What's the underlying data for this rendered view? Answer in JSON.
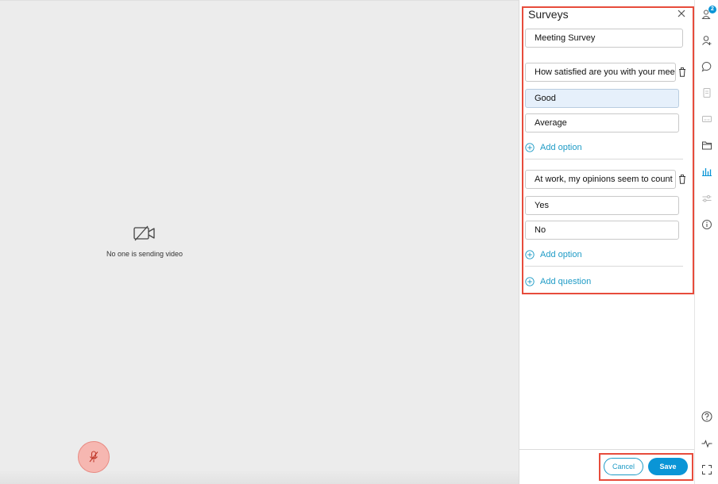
{
  "stage": {
    "no_video_text": "No one is sending video",
    "mute_icon": "microphone-muted-icon"
  },
  "survey": {
    "title": "Surveys",
    "close_icon": "close-icon",
    "name_value": "Meeting Survey",
    "questions": [
      {
        "text": "How satisfied are you with your meeting",
        "options": [
          "Good",
          "Average"
        ],
        "selected_option": "Good"
      },
      {
        "text": "At work, my opinions seem to count",
        "options": [
          "Yes",
          "No"
        ]
      }
    ],
    "add_option_label": "Add option",
    "add_question_label": "Add question",
    "cancel_label": "Cancel",
    "save_label": "Save"
  },
  "rail": {
    "participants_badge": "2",
    "icons": [
      "participants-icon",
      "add-person-icon",
      "chat-icon",
      "notes-icon",
      "captions-icon",
      "files-icon",
      "polling-icon",
      "settings-icon",
      "info-icon",
      "help-icon",
      "network-icon",
      "fullscreen-icon"
    ]
  },
  "colors": {
    "accent": "#0a95d6",
    "link": "#1e9bc6",
    "highlight": "#e74c3c",
    "selected_option_bg": "#e6f0fb",
    "stage_bg": "#ececec",
    "mute_bg": "#f6b7b1"
  }
}
